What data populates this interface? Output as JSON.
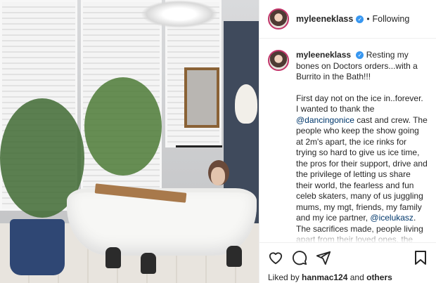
{
  "post": {
    "username": "myleeneklass",
    "follow_status": "Following",
    "separator": "•",
    "verified_mark": "✓",
    "caption_lead": "Resting my bones on Doctors orders...with a Burrito in the Bath!!!",
    "caption_p1_a": "First day not on the ice in..forever. I wanted to thank the ",
    "mention_1": "@dancingonice",
    "caption_p1_b": " cast and crew. The people who keep the show going at 2m's apart, the ice rinks for trying so hard to give us ice time, the pros for their support, drive and the privilege of letting us share their world, the fearless and fun celeb skaters, many of us juggling mums, my mgt, friends, my family and my ice partner, ",
    "mention_2": "@icelukasz",
    "caption_p1_c": ". The sacrifices made, people living apart from their loved ones, the virtual hugging and support every time one of us hit the ice, the online distanced physio sessions first aid and goggles the...",
    "liked_prefix": "Liked by ",
    "liked_user": "hanmac124",
    "liked_suffix": " and ",
    "liked_others": "others"
  },
  "icons": {
    "like": "heart-icon",
    "comment": "comment-icon",
    "share": "send-icon",
    "save": "bookmark-icon"
  },
  "colors": {
    "verified": "#3897f0",
    "mention": "#00376b",
    "avatar_ring": "#c2356a",
    "text": "#262626"
  }
}
